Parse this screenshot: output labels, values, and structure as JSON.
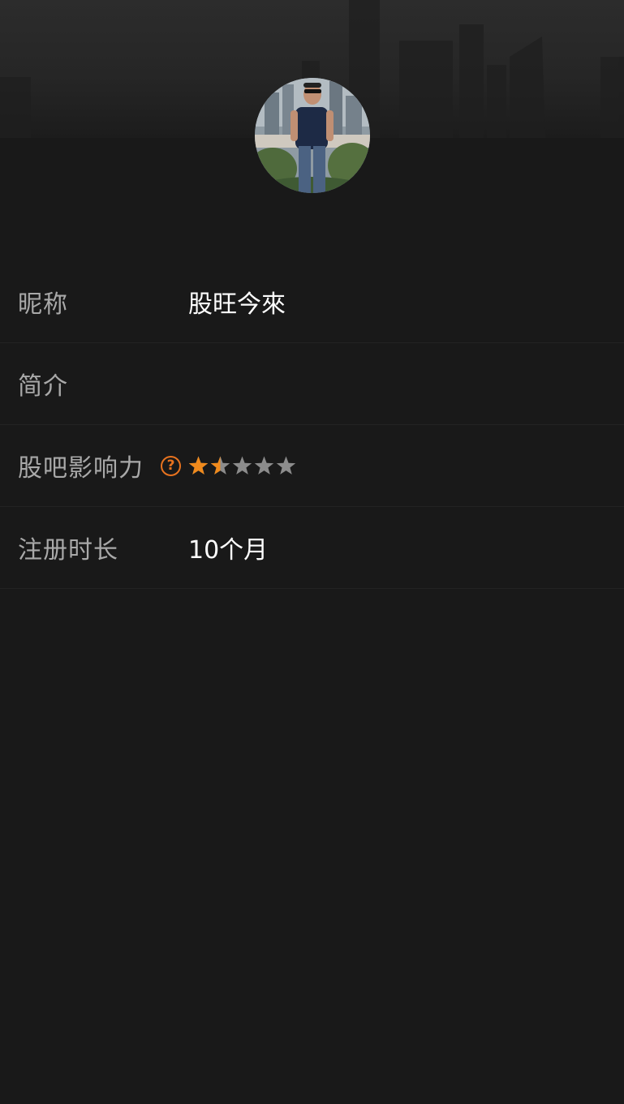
{
  "profile": {
    "avatar_icon": "user-avatar-photo"
  },
  "rows": {
    "nickname": {
      "label": "昵称",
      "value": "股旺今來"
    },
    "bio": {
      "label": "简介",
      "value": ""
    },
    "influence": {
      "label": "股吧影响力",
      "help_icon": "question-circle-icon",
      "help_glyph": "?",
      "rating": 1.5,
      "max_rating": 5
    },
    "registered": {
      "label": "注册时长",
      "value": "10个月"
    }
  },
  "colors": {
    "background": "#191919",
    "label": "#a9a9a9",
    "value": "#ffffff",
    "accent": "#e8731f",
    "star_filled": "#f08a1c",
    "star_empty": "#8c8c8c",
    "divider": "#232323"
  }
}
